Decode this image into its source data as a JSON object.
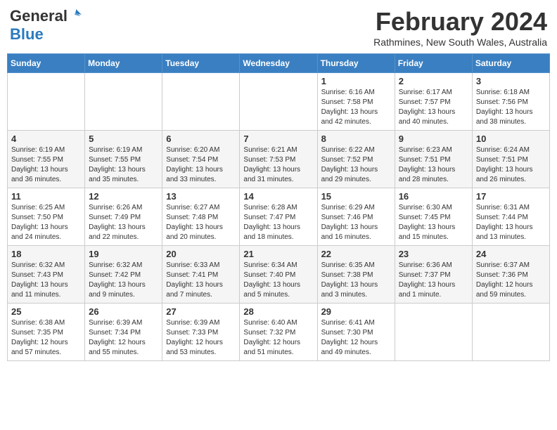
{
  "header": {
    "logo_general": "General",
    "logo_blue": "Blue",
    "month_year": "February 2024",
    "location": "Rathmines, New South Wales, Australia"
  },
  "days_of_week": [
    "Sunday",
    "Monday",
    "Tuesday",
    "Wednesday",
    "Thursday",
    "Friday",
    "Saturday"
  ],
  "weeks": [
    [
      {
        "day": "",
        "info": ""
      },
      {
        "day": "",
        "info": ""
      },
      {
        "day": "",
        "info": ""
      },
      {
        "day": "",
        "info": ""
      },
      {
        "day": "1",
        "info": "Sunrise: 6:16 AM\nSunset: 7:58 PM\nDaylight: 13 hours\nand 42 minutes."
      },
      {
        "day": "2",
        "info": "Sunrise: 6:17 AM\nSunset: 7:57 PM\nDaylight: 13 hours\nand 40 minutes."
      },
      {
        "day": "3",
        "info": "Sunrise: 6:18 AM\nSunset: 7:56 PM\nDaylight: 13 hours\nand 38 minutes."
      }
    ],
    [
      {
        "day": "4",
        "info": "Sunrise: 6:19 AM\nSunset: 7:55 PM\nDaylight: 13 hours\nand 36 minutes."
      },
      {
        "day": "5",
        "info": "Sunrise: 6:19 AM\nSunset: 7:55 PM\nDaylight: 13 hours\nand 35 minutes."
      },
      {
        "day": "6",
        "info": "Sunrise: 6:20 AM\nSunset: 7:54 PM\nDaylight: 13 hours\nand 33 minutes."
      },
      {
        "day": "7",
        "info": "Sunrise: 6:21 AM\nSunset: 7:53 PM\nDaylight: 13 hours\nand 31 minutes."
      },
      {
        "day": "8",
        "info": "Sunrise: 6:22 AM\nSunset: 7:52 PM\nDaylight: 13 hours\nand 29 minutes."
      },
      {
        "day": "9",
        "info": "Sunrise: 6:23 AM\nSunset: 7:51 PM\nDaylight: 13 hours\nand 28 minutes."
      },
      {
        "day": "10",
        "info": "Sunrise: 6:24 AM\nSunset: 7:51 PM\nDaylight: 13 hours\nand 26 minutes."
      }
    ],
    [
      {
        "day": "11",
        "info": "Sunrise: 6:25 AM\nSunset: 7:50 PM\nDaylight: 13 hours\nand 24 minutes."
      },
      {
        "day": "12",
        "info": "Sunrise: 6:26 AM\nSunset: 7:49 PM\nDaylight: 13 hours\nand 22 minutes."
      },
      {
        "day": "13",
        "info": "Sunrise: 6:27 AM\nSunset: 7:48 PM\nDaylight: 13 hours\nand 20 minutes."
      },
      {
        "day": "14",
        "info": "Sunrise: 6:28 AM\nSunset: 7:47 PM\nDaylight: 13 hours\nand 18 minutes."
      },
      {
        "day": "15",
        "info": "Sunrise: 6:29 AM\nSunset: 7:46 PM\nDaylight: 13 hours\nand 16 minutes."
      },
      {
        "day": "16",
        "info": "Sunrise: 6:30 AM\nSunset: 7:45 PM\nDaylight: 13 hours\nand 15 minutes."
      },
      {
        "day": "17",
        "info": "Sunrise: 6:31 AM\nSunset: 7:44 PM\nDaylight: 13 hours\nand 13 minutes."
      }
    ],
    [
      {
        "day": "18",
        "info": "Sunrise: 6:32 AM\nSunset: 7:43 PM\nDaylight: 13 hours\nand 11 minutes."
      },
      {
        "day": "19",
        "info": "Sunrise: 6:32 AM\nSunset: 7:42 PM\nDaylight: 13 hours\nand 9 minutes."
      },
      {
        "day": "20",
        "info": "Sunrise: 6:33 AM\nSunset: 7:41 PM\nDaylight: 13 hours\nand 7 minutes."
      },
      {
        "day": "21",
        "info": "Sunrise: 6:34 AM\nSunset: 7:40 PM\nDaylight: 13 hours\nand 5 minutes."
      },
      {
        "day": "22",
        "info": "Sunrise: 6:35 AM\nSunset: 7:38 PM\nDaylight: 13 hours\nand 3 minutes."
      },
      {
        "day": "23",
        "info": "Sunrise: 6:36 AM\nSunset: 7:37 PM\nDaylight: 13 hours\nand 1 minute."
      },
      {
        "day": "24",
        "info": "Sunrise: 6:37 AM\nSunset: 7:36 PM\nDaylight: 12 hours\nand 59 minutes."
      }
    ],
    [
      {
        "day": "25",
        "info": "Sunrise: 6:38 AM\nSunset: 7:35 PM\nDaylight: 12 hours\nand 57 minutes."
      },
      {
        "day": "26",
        "info": "Sunrise: 6:39 AM\nSunset: 7:34 PM\nDaylight: 12 hours\nand 55 minutes."
      },
      {
        "day": "27",
        "info": "Sunrise: 6:39 AM\nSunset: 7:33 PM\nDaylight: 12 hours\nand 53 minutes."
      },
      {
        "day": "28",
        "info": "Sunrise: 6:40 AM\nSunset: 7:32 PM\nDaylight: 12 hours\nand 51 minutes."
      },
      {
        "day": "29",
        "info": "Sunrise: 6:41 AM\nSunset: 7:30 PM\nDaylight: 12 hours\nand 49 minutes."
      },
      {
        "day": "",
        "info": ""
      },
      {
        "day": "",
        "info": ""
      }
    ]
  ]
}
